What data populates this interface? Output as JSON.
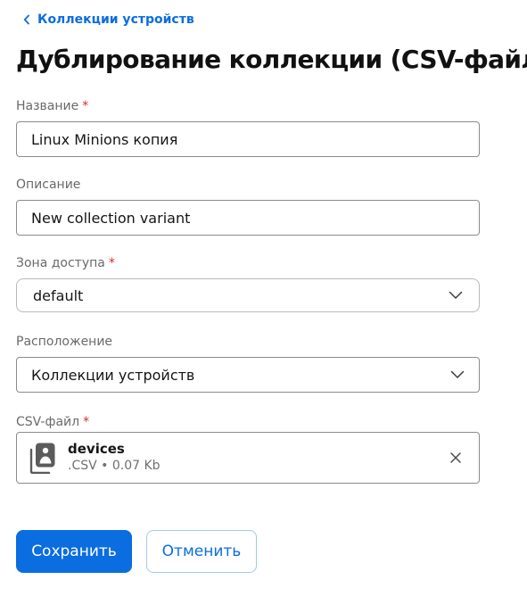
{
  "breadcrumb": {
    "label": "Коллекции устройств"
  },
  "page": {
    "title": "Дублирование коллекции (CSV-файл)"
  },
  "form": {
    "required_marker": "*",
    "name": {
      "label": "Название",
      "value": "Linux Minions копия"
    },
    "description": {
      "label": "Описание",
      "value": "New collection variant"
    },
    "access_zone": {
      "label": "Зона доступа",
      "value": "default"
    },
    "location": {
      "label": "Расположение",
      "value": "Коллекции устройств"
    },
    "csv_file": {
      "label": "CSV-файл",
      "file_name": "devices",
      "file_meta": ".CSV • 0.07 Kb"
    }
  },
  "actions": {
    "save_label": "Сохранить",
    "cancel_label": "Отменить"
  },
  "colors": {
    "accent": "#0a6de0",
    "required": "#d62b2b",
    "border": "#8b8b8b"
  },
  "icons": {
    "back": "chevron-left-icon",
    "dropdown": "chevron-down-icon",
    "file": "file-image-icon",
    "remove": "close-icon"
  }
}
